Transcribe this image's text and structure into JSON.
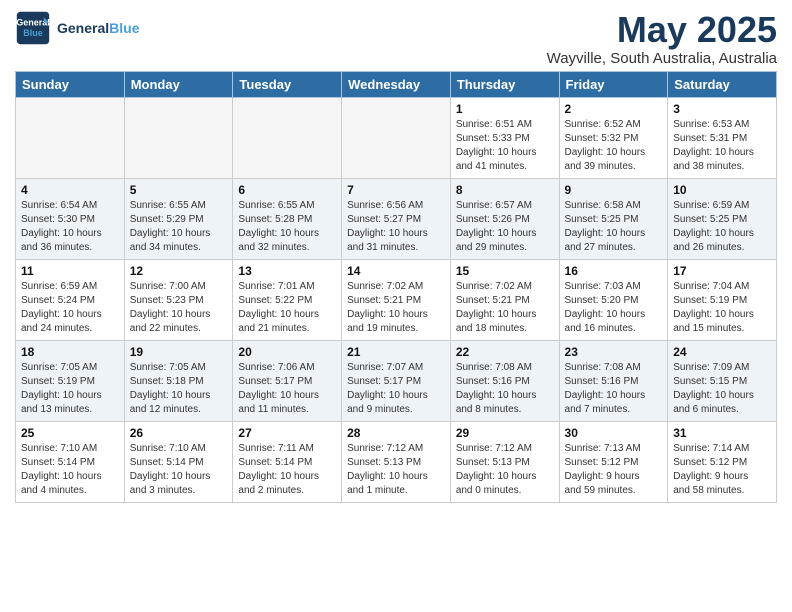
{
  "app": {
    "logo_line1": "General",
    "logo_line2": "Blue"
  },
  "header": {
    "title": "May 2025",
    "subtitle": "Wayville, South Australia, Australia"
  },
  "calendar": {
    "days_of_week": [
      "Sunday",
      "Monday",
      "Tuesday",
      "Wednesday",
      "Thursday",
      "Friday",
      "Saturday"
    ],
    "weeks": [
      [
        {
          "day": "",
          "info": ""
        },
        {
          "day": "",
          "info": ""
        },
        {
          "day": "",
          "info": ""
        },
        {
          "day": "",
          "info": ""
        },
        {
          "day": "1",
          "info": "Sunrise: 6:51 AM\nSunset: 5:33 PM\nDaylight: 10 hours\nand 41 minutes."
        },
        {
          "day": "2",
          "info": "Sunrise: 6:52 AM\nSunset: 5:32 PM\nDaylight: 10 hours\nand 39 minutes."
        },
        {
          "day": "3",
          "info": "Sunrise: 6:53 AM\nSunset: 5:31 PM\nDaylight: 10 hours\nand 38 minutes."
        }
      ],
      [
        {
          "day": "4",
          "info": "Sunrise: 6:54 AM\nSunset: 5:30 PM\nDaylight: 10 hours\nand 36 minutes."
        },
        {
          "day": "5",
          "info": "Sunrise: 6:55 AM\nSunset: 5:29 PM\nDaylight: 10 hours\nand 34 minutes."
        },
        {
          "day": "6",
          "info": "Sunrise: 6:55 AM\nSunset: 5:28 PM\nDaylight: 10 hours\nand 32 minutes."
        },
        {
          "day": "7",
          "info": "Sunrise: 6:56 AM\nSunset: 5:27 PM\nDaylight: 10 hours\nand 31 minutes."
        },
        {
          "day": "8",
          "info": "Sunrise: 6:57 AM\nSunset: 5:26 PM\nDaylight: 10 hours\nand 29 minutes."
        },
        {
          "day": "9",
          "info": "Sunrise: 6:58 AM\nSunset: 5:25 PM\nDaylight: 10 hours\nand 27 minutes."
        },
        {
          "day": "10",
          "info": "Sunrise: 6:59 AM\nSunset: 5:25 PM\nDaylight: 10 hours\nand 26 minutes."
        }
      ],
      [
        {
          "day": "11",
          "info": "Sunrise: 6:59 AM\nSunset: 5:24 PM\nDaylight: 10 hours\nand 24 minutes."
        },
        {
          "day": "12",
          "info": "Sunrise: 7:00 AM\nSunset: 5:23 PM\nDaylight: 10 hours\nand 22 minutes."
        },
        {
          "day": "13",
          "info": "Sunrise: 7:01 AM\nSunset: 5:22 PM\nDaylight: 10 hours\nand 21 minutes."
        },
        {
          "day": "14",
          "info": "Sunrise: 7:02 AM\nSunset: 5:21 PM\nDaylight: 10 hours\nand 19 minutes."
        },
        {
          "day": "15",
          "info": "Sunrise: 7:02 AM\nSunset: 5:21 PM\nDaylight: 10 hours\nand 18 minutes."
        },
        {
          "day": "16",
          "info": "Sunrise: 7:03 AM\nSunset: 5:20 PM\nDaylight: 10 hours\nand 16 minutes."
        },
        {
          "day": "17",
          "info": "Sunrise: 7:04 AM\nSunset: 5:19 PM\nDaylight: 10 hours\nand 15 minutes."
        }
      ],
      [
        {
          "day": "18",
          "info": "Sunrise: 7:05 AM\nSunset: 5:19 PM\nDaylight: 10 hours\nand 13 minutes."
        },
        {
          "day": "19",
          "info": "Sunrise: 7:05 AM\nSunset: 5:18 PM\nDaylight: 10 hours\nand 12 minutes."
        },
        {
          "day": "20",
          "info": "Sunrise: 7:06 AM\nSunset: 5:17 PM\nDaylight: 10 hours\nand 11 minutes."
        },
        {
          "day": "21",
          "info": "Sunrise: 7:07 AM\nSunset: 5:17 PM\nDaylight: 10 hours\nand 9 minutes."
        },
        {
          "day": "22",
          "info": "Sunrise: 7:08 AM\nSunset: 5:16 PM\nDaylight: 10 hours\nand 8 minutes."
        },
        {
          "day": "23",
          "info": "Sunrise: 7:08 AM\nSunset: 5:16 PM\nDaylight: 10 hours\nand 7 minutes."
        },
        {
          "day": "24",
          "info": "Sunrise: 7:09 AM\nSunset: 5:15 PM\nDaylight: 10 hours\nand 6 minutes."
        }
      ],
      [
        {
          "day": "25",
          "info": "Sunrise: 7:10 AM\nSunset: 5:14 PM\nDaylight: 10 hours\nand 4 minutes."
        },
        {
          "day": "26",
          "info": "Sunrise: 7:10 AM\nSunset: 5:14 PM\nDaylight: 10 hours\nand 3 minutes."
        },
        {
          "day": "27",
          "info": "Sunrise: 7:11 AM\nSunset: 5:14 PM\nDaylight: 10 hours\nand 2 minutes."
        },
        {
          "day": "28",
          "info": "Sunrise: 7:12 AM\nSunset: 5:13 PM\nDaylight: 10 hours\nand 1 minute."
        },
        {
          "day": "29",
          "info": "Sunrise: 7:12 AM\nSunset: 5:13 PM\nDaylight: 10 hours\nand 0 minutes."
        },
        {
          "day": "30",
          "info": "Sunrise: 7:13 AM\nSunset: 5:12 PM\nDaylight: 9 hours\nand 59 minutes."
        },
        {
          "day": "31",
          "info": "Sunrise: 7:14 AM\nSunset: 5:12 PM\nDaylight: 9 hours\nand 58 minutes."
        }
      ]
    ]
  }
}
